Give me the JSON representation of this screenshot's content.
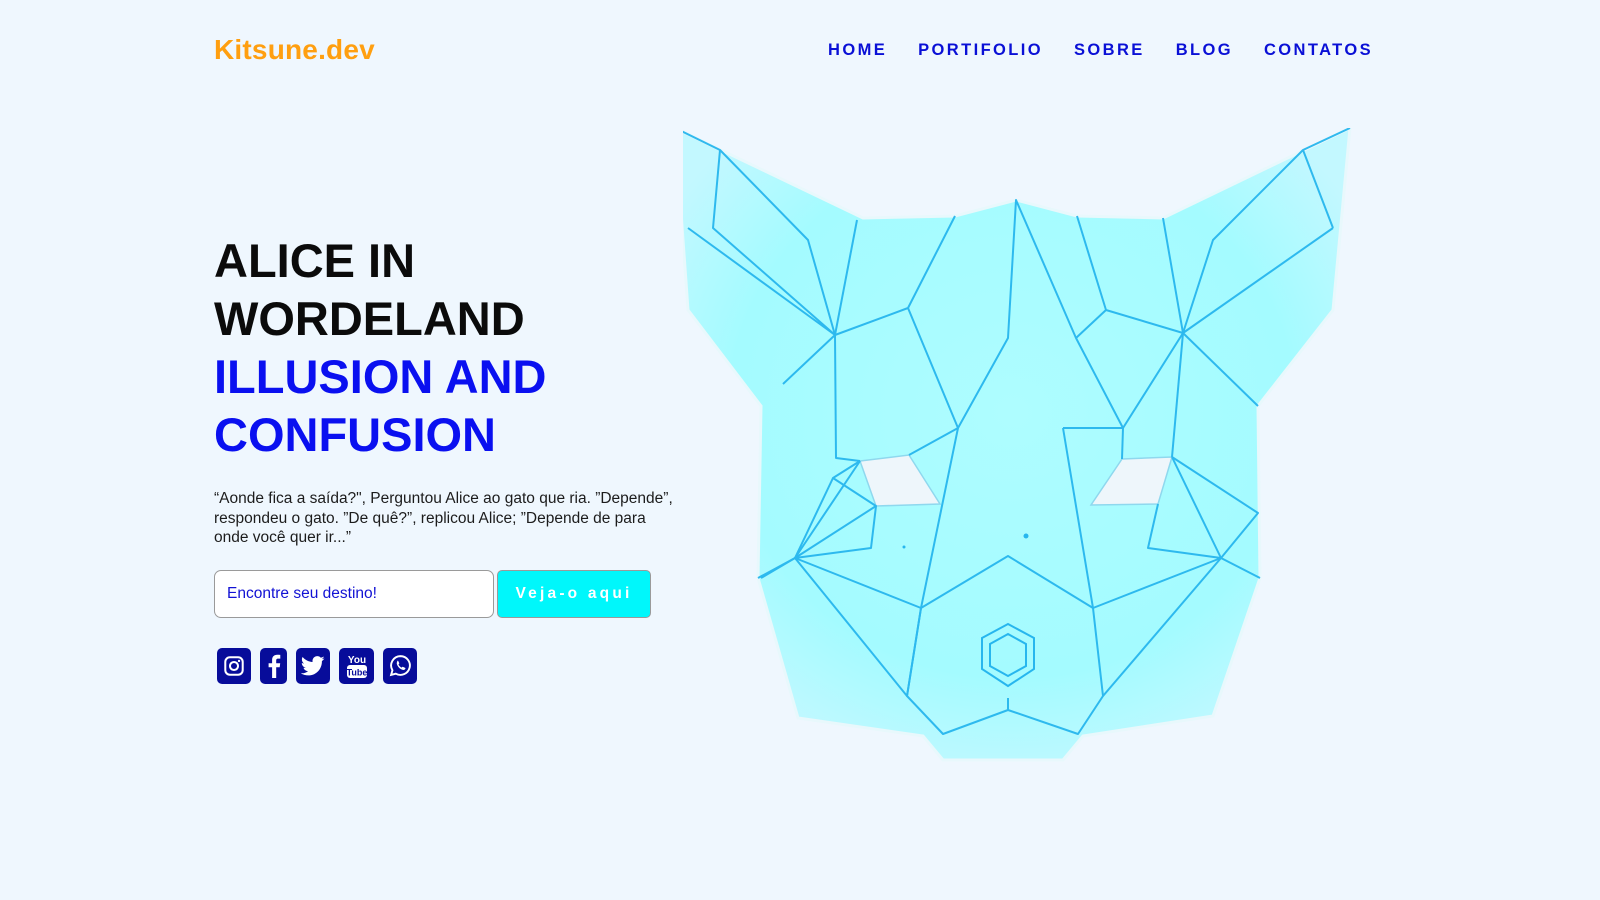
{
  "header": {
    "logo": "Kitsune.dev",
    "nav": [
      "HOME",
      "PORTIFOLIO",
      "SOBRE",
      "BLOG",
      "CONTATOS"
    ]
  },
  "hero": {
    "headline_line1": "ALICE IN",
    "headline_line2": "WORDELAND",
    "headline_accent_line1": "ILLUSION AND",
    "headline_accent_line2": "CONFUSION",
    "description": "“Aonde fica a saída?\", Perguntou Alice ao gato que ria. ”Depende”, respondeu o gato. ”De quê?”, replicou Alice; ”Depende de para onde você quer ir...”",
    "search": {
      "placeholder": "Encontre seu destino!",
      "value": ""
    },
    "cta_label": "Veja-o aqui"
  },
  "socials": [
    {
      "icon": "instagram-icon"
    },
    {
      "icon": "facebook-icon"
    },
    {
      "icon": "twitter-icon"
    },
    {
      "icon": "youtube-icon"
    },
    {
      "icon": "whatsapp-icon"
    }
  ],
  "colors": {
    "background": "#eff7fe",
    "logo": "#ff9f10",
    "nav": "#0a10d6",
    "accent": "#0a10f0",
    "cta": "#00f7fb",
    "social": "#070c9a",
    "mask_fill": "#a6fcff",
    "mask_lines": "#27b6ee"
  }
}
